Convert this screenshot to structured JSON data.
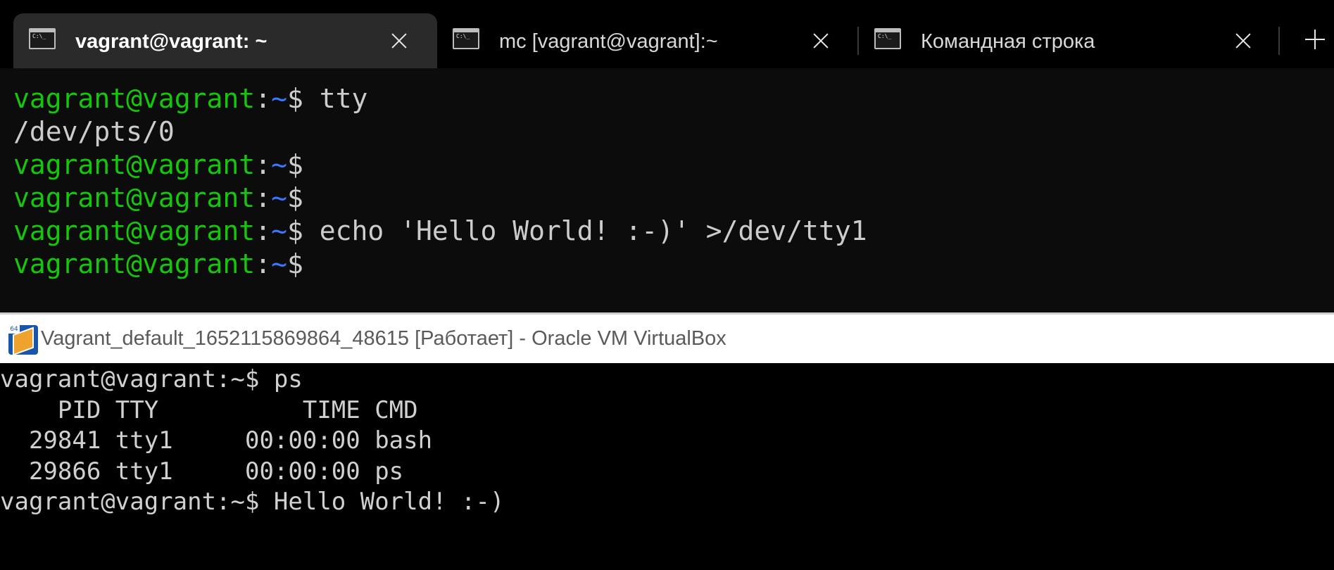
{
  "tabbar": {
    "tabs": [
      {
        "title": "vagrant@vagrant: ~",
        "icon": "console-icon",
        "active": true
      },
      {
        "title": "mc [vagrant@vagrant]:~",
        "icon": "console-icon",
        "active": false
      },
      {
        "title": "Командная строка",
        "icon": "console-icon",
        "active": false
      }
    ],
    "new_tab_icon": "plus-icon",
    "close_icon": "close-icon"
  },
  "terminal": {
    "prompt": {
      "user": "vagrant@vagrant",
      "colon": ":",
      "dir": "~",
      "dollar": "$"
    },
    "lines": [
      {
        "type": "prompt",
        "command": " tty"
      },
      {
        "type": "output",
        "text": "/dev/pts/0"
      },
      {
        "type": "prompt",
        "command": ""
      },
      {
        "type": "prompt",
        "command": ""
      },
      {
        "type": "prompt",
        "command": " echo 'Hello World! :-)' >/dev/tty1"
      },
      {
        "type": "prompt",
        "command": ""
      }
    ],
    "colors": {
      "user": "#16c60c",
      "dir": "#3b78ff",
      "text": "#cccccc",
      "background": "#0c0c0c"
    }
  },
  "vbox": {
    "title": "Vagrant_default_1652115869864_48615 [Работает] - Oracle VM VirtualBox",
    "logo_badge": "64",
    "console_lines": [
      "vagrant@vagrant:~$ ps",
      "    PID TTY          TIME CMD",
      "  29841 tty1     00:00:00 bash",
      "  29866 tty1     00:00:00 ps",
      "vagrant@vagrant:~$ Hello World! :-)"
    ]
  }
}
